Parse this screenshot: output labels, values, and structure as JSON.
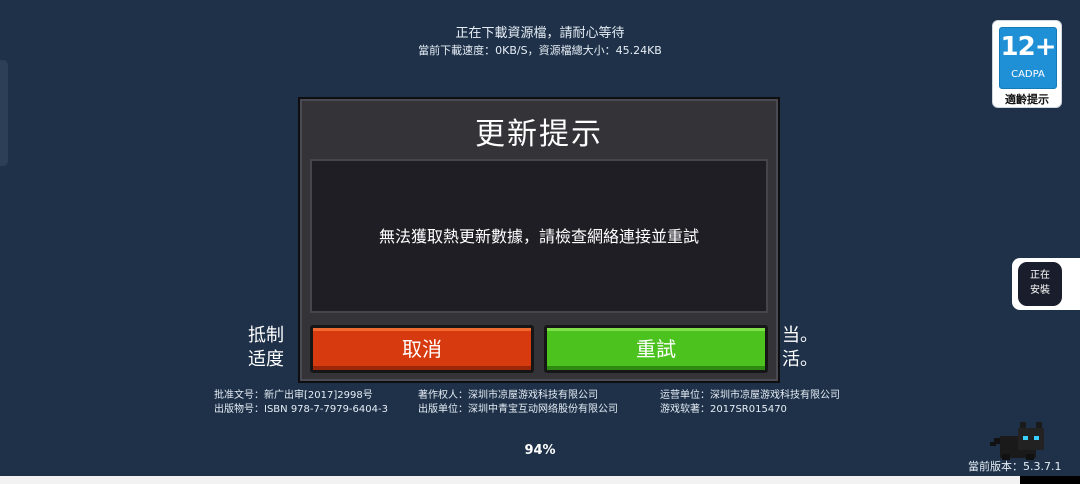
{
  "status": {
    "line1": "正在下載資源檔，請耐心等待",
    "line2": "當前下載速度：0KB/S，資源檔總大小：45.24KB"
  },
  "age_badge": {
    "rating": "12+",
    "org": "CADPA",
    "label": "適齡提示"
  },
  "install_widget": {
    "line1": "正在",
    "line2": "安裝"
  },
  "background_text": {
    "line1_left": "抵制",
    "line1_right": "当。",
    "line2_left": "适度",
    "line2_right": "活。"
  },
  "license": {
    "approval": "批准文号：新广出审[2017]2998号",
    "copyright": "著作权人：深圳市凉屋游戏科技有限公司",
    "operator": "运营单位：深圳市凉屋游戏科技有限公司",
    "isbn": "出版物号：ISBN 978-7-7979-6404-3",
    "publisher": "出版单位：深圳中青宝互动网络股份有限公司",
    "software_reg": "游戏软著：2017SR015470"
  },
  "progress": {
    "percent_label": "94%",
    "value": 94
  },
  "version": {
    "label": "當前版本：",
    "value": "5.3.7.1"
  },
  "modal": {
    "title": "更新提示",
    "message": "無法獲取熱更新數據，請檢查網絡連接並重試",
    "cancel_label": "取消",
    "retry_label": "重試"
  },
  "colors": {
    "background": "#1e3149",
    "modal": "#333338",
    "cancel_button": "#d83a10",
    "retry_button": "#4cc21e",
    "badge_blue": "#1f8fd6"
  },
  "icons": [
    "cat-character-icon",
    "installing-app-icon"
  ]
}
